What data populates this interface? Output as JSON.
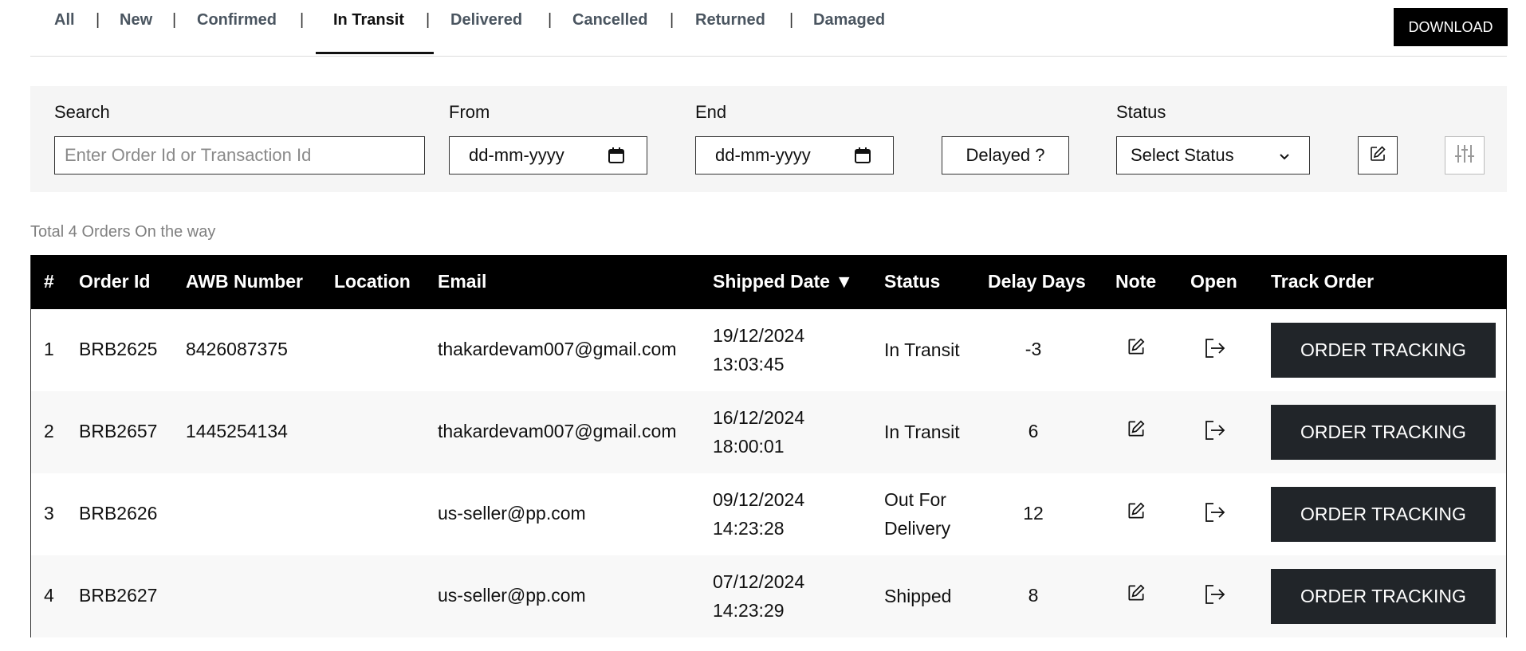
{
  "tabs": [
    {
      "label": "All"
    },
    {
      "label": "New"
    },
    {
      "label": "Confirmed"
    },
    {
      "label": "In Transit"
    },
    {
      "label": "Delivered"
    },
    {
      "label": "Cancelled"
    },
    {
      "label": "Returned"
    },
    {
      "label": "Damaged"
    }
  ],
  "tab_separator": "|",
  "active_tab": "In Transit",
  "download_label": "DOWNLOAD",
  "filters": {
    "search_label": "Search",
    "search_placeholder": "Enter Order Id or Transaction Id",
    "from_label": "From",
    "from_value": "dd-mm-yyyy",
    "end_label": "End",
    "end_value": "dd-mm-yyyy",
    "delayed_label": "Delayed ?",
    "status_label": "Status",
    "status_value": "Select Status"
  },
  "summary": "Total 4 Orders On the way",
  "table": {
    "headers": {
      "num": "#",
      "order_id": "Order Id",
      "awb": "AWB Number",
      "location": "Location",
      "email": "Email",
      "shipped": "Shipped Date ▼",
      "status": "Status",
      "delay": "Delay Days",
      "note": "Note",
      "open": "Open",
      "track": "Track Order"
    },
    "track_label": "ORDER TRACKING",
    "rows": [
      {
        "num": "1",
        "order_id": "BRB2625",
        "awb": "8426087375",
        "location": "",
        "email": "thakardevam007@gmail.com",
        "date": "19/12/2024",
        "time": "13:03:45",
        "status_l1": "In Transit",
        "status_l2": "",
        "delay": "-3"
      },
      {
        "num": "2",
        "order_id": "BRB2657",
        "awb": "1445254134",
        "location": "",
        "email": "thakardevam007@gmail.com",
        "date": "16/12/2024",
        "time": "18:00:01",
        "status_l1": "In Transit",
        "status_l2": "",
        "delay": "6"
      },
      {
        "num": "3",
        "order_id": "BRB2626",
        "awb": "",
        "location": "",
        "email": "us-seller@pp.com",
        "date": "09/12/2024",
        "time": "14:23:28",
        "status_l1": "Out For",
        "status_l2": "Delivery",
        "delay": "12"
      },
      {
        "num": "4",
        "order_id": "BRB2627",
        "awb": "",
        "location": "",
        "email": "us-seller@pp.com",
        "date": "07/12/2024",
        "time": "14:23:29",
        "status_l1": "Shipped",
        "status_l2": "",
        "delay": "8"
      }
    ]
  }
}
